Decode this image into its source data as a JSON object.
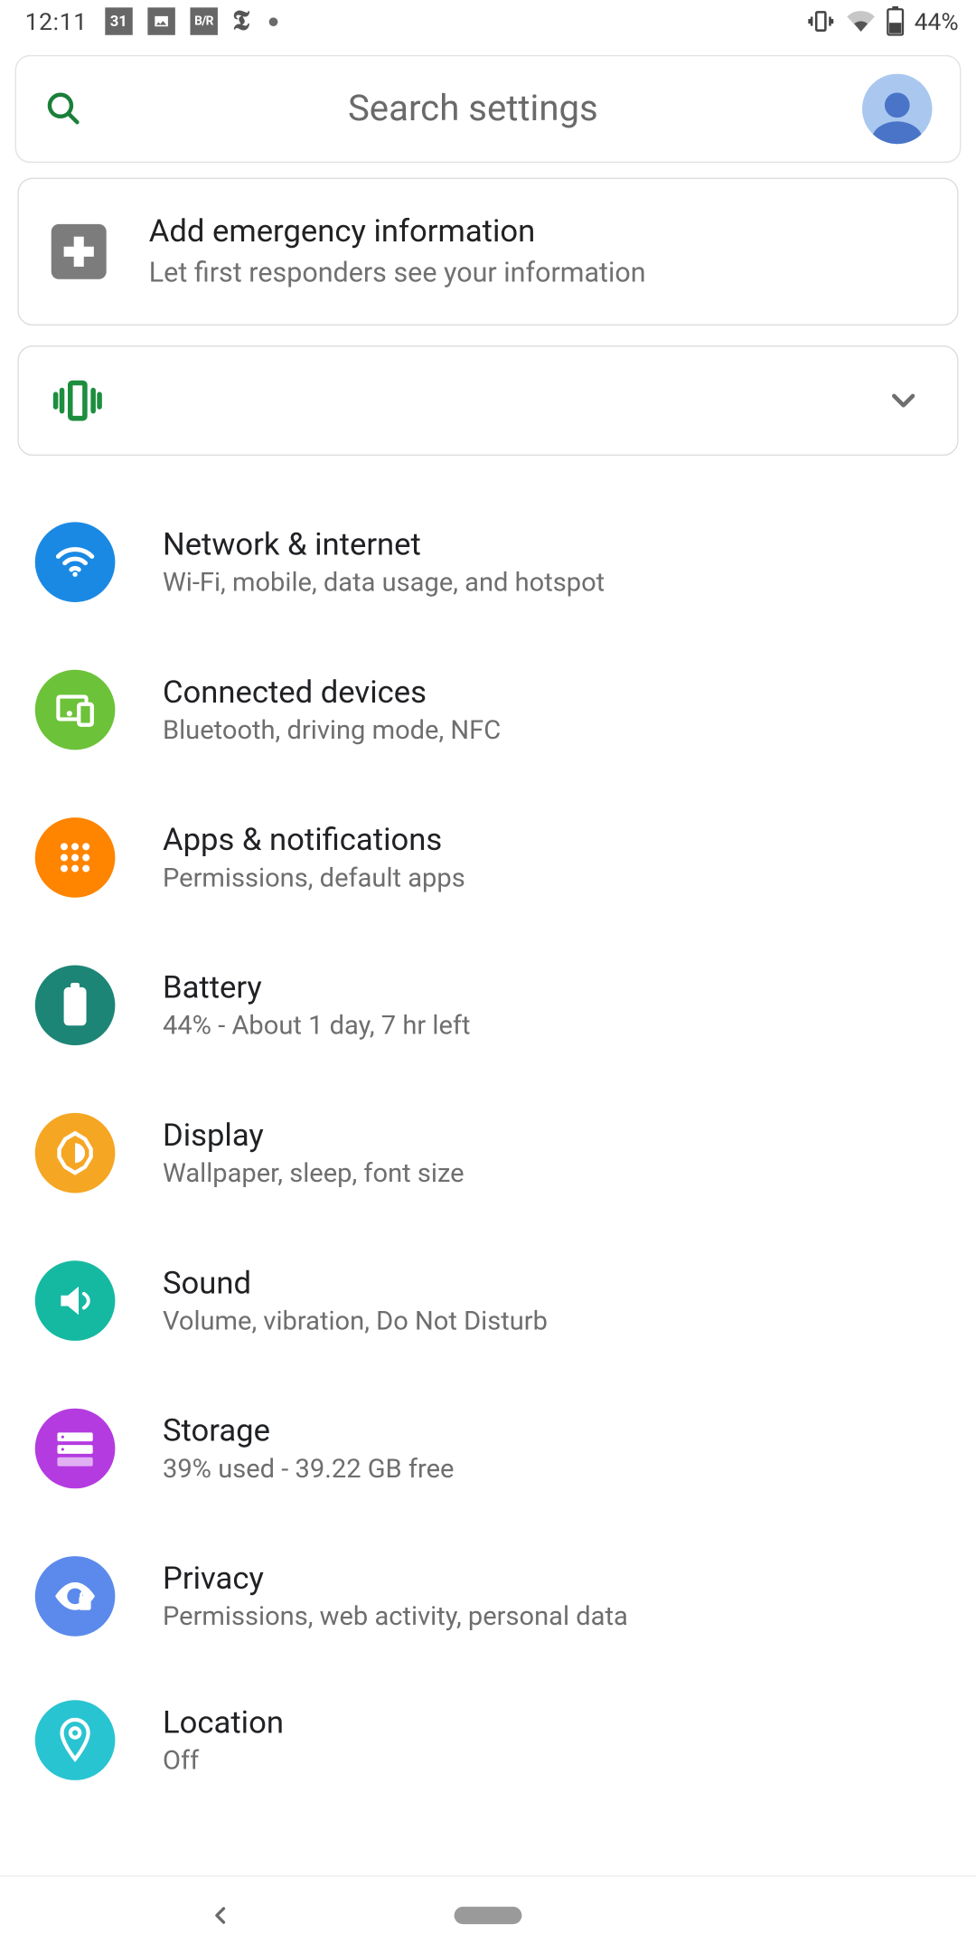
{
  "status": {
    "time": "12:11",
    "battery_percent": "44%",
    "icons_left": [
      "calendar-31",
      "photo",
      "br",
      "nyt",
      "dot"
    ]
  },
  "search": {
    "placeholder": "Search settings"
  },
  "emergency": {
    "title": "Add emergency information",
    "subtitle": "Let first responders see your information"
  },
  "items": [
    {
      "id": "network",
      "title": "Network & internet",
      "subtitle": "Wi-Fi, mobile, data usage, and hotspot"
    },
    {
      "id": "devices",
      "title": "Connected devices",
      "subtitle": "Bluetooth, driving mode, NFC"
    },
    {
      "id": "apps",
      "title": "Apps & notifications",
      "subtitle": "Permissions, default apps"
    },
    {
      "id": "battery",
      "title": "Battery",
      "subtitle": "44% - About 1 day, 7 hr left"
    },
    {
      "id": "display",
      "title": "Display",
      "subtitle": "Wallpaper, sleep, font size"
    },
    {
      "id": "sound",
      "title": "Sound",
      "subtitle": "Volume, vibration, Do Not Disturb"
    },
    {
      "id": "storage",
      "title": "Storage",
      "subtitle": "39% used - 39.22 GB free"
    },
    {
      "id": "privacy",
      "title": "Privacy",
      "subtitle": "Permissions, web activity, personal data"
    },
    {
      "id": "location",
      "title": "Location",
      "subtitle": "Off"
    }
  ]
}
